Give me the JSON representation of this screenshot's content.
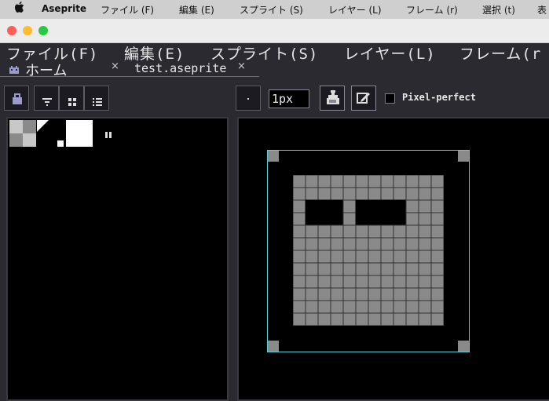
{
  "mac_menubar": {
    "apple": "",
    "app_name": "Aseprite",
    "items": [
      "ファイル (F)",
      "編集 (E)",
      "スプライト (S)",
      "レイヤー (L)",
      "フレーム (r)",
      "選択 (t)",
      "表"
    ]
  },
  "window": {
    "traffic_lights": [
      "#ff5f57",
      "#febc2e",
      "#28c840"
    ]
  },
  "app_menu": {
    "items": [
      "ファイル(F)",
      "編集(E)",
      "スプライト(S)",
      "レイヤー(L)",
      "フレーム(r"
    ]
  },
  "tabs": [
    {
      "label": "ホーム",
      "icon": "home-icon"
    },
    {
      "label": "test.aseprite",
      "icon": "close-icon"
    }
  ],
  "toolbar": {
    "brush_size_value": "1px",
    "pixel_perfect_label": "Pixel-perfect",
    "pixel_perfect_checked": false
  },
  "colors": {
    "background": "#2b2a31",
    "canvas_border": "#5fd0d8",
    "sprite_fill": "#8a8a8a",
    "sprite_grid": "#333333"
  },
  "sprite": {
    "grid_cols": 12,
    "grid_rows": 12,
    "eyes": [
      {
        "row_start": 2,
        "row_end": 3,
        "col_start": 1,
        "col_end": 3
      },
      {
        "row_start": 2,
        "row_end": 3,
        "col_start": 5,
        "col_end": 8
      }
    ]
  }
}
